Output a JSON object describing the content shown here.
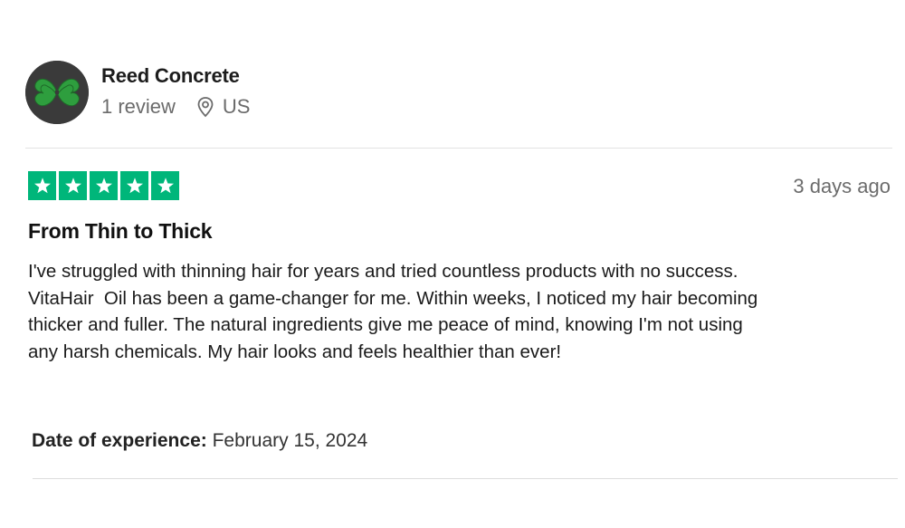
{
  "reviewer": {
    "name": "Reed Concrete",
    "review_count": "1 review",
    "country": "US",
    "avatar_icon": "clover-icon"
  },
  "review": {
    "rating": 5,
    "rating_max": 5,
    "star_color": "#00b67a",
    "posted": "3 days ago",
    "title": "From Thin to Thick",
    "body": "I've struggled with thinning hair for years and tried countless products with no success.\nVitaHair  Oil has been a game-changer for me. Within weeks, I noticed my hair becoming\nthicker and fuller. The natural ingredients give me peace of mind, knowing I'm not using\nany harsh chemicals. My hair looks and feels healthier than ever!",
    "experience_label": "Date of experience:",
    "experience_date": "February 15, 2024"
  }
}
